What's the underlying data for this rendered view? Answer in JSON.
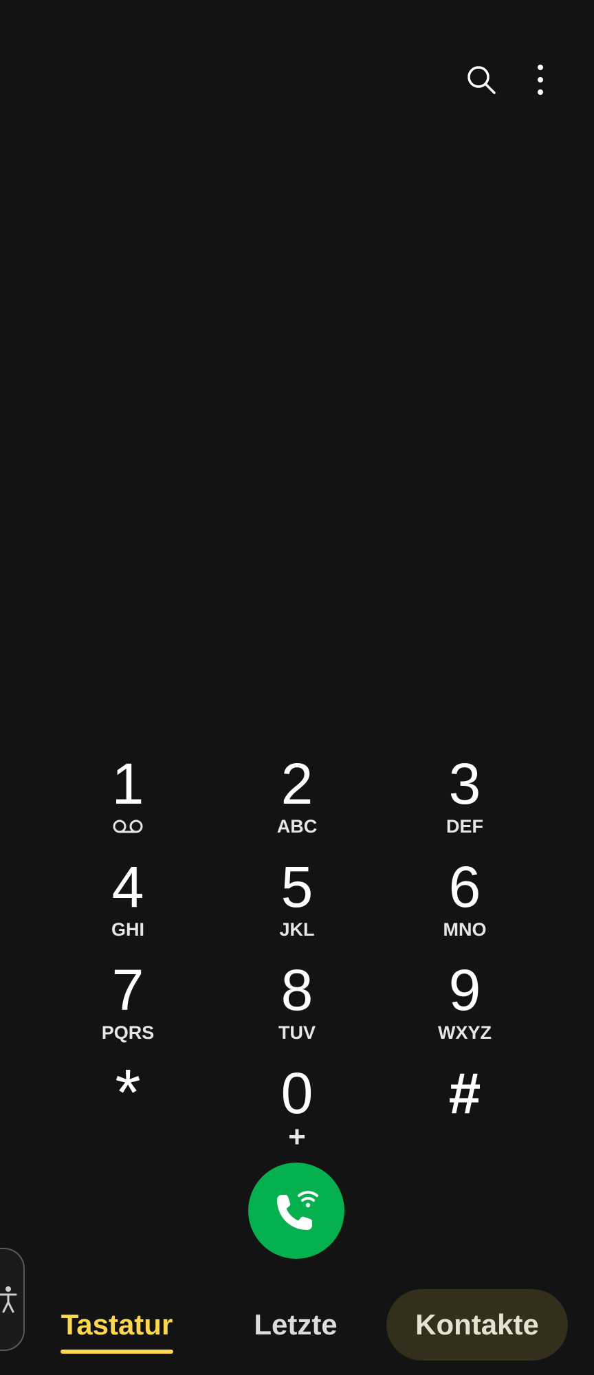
{
  "top_bar": {
    "search_icon": "search-icon",
    "more_icon": "more-vertical-icon"
  },
  "keypad": {
    "rows": [
      [
        {
          "digit": "1",
          "letters": "",
          "icon": "voicemail-icon"
        },
        {
          "digit": "2",
          "letters": "ABC"
        },
        {
          "digit": "3",
          "letters": "DEF"
        }
      ],
      [
        {
          "digit": "4",
          "letters": "GHI"
        },
        {
          "digit": "5",
          "letters": "JKL"
        },
        {
          "digit": "6",
          "letters": "MNO"
        }
      ],
      [
        {
          "digit": "7",
          "letters": "PQRS"
        },
        {
          "digit": "8",
          "letters": "TUV"
        },
        {
          "digit": "9",
          "letters": "WXYZ"
        }
      ],
      [
        {
          "digit": "*",
          "letters": ""
        },
        {
          "digit": "0",
          "letters": "+"
        },
        {
          "digit": "#",
          "letters": ""
        }
      ]
    ]
  },
  "call_button": {
    "icon": "wifi-call-icon",
    "color": "#05b04f"
  },
  "accessibility": {
    "icon": "accessibility-icon"
  },
  "bottom_nav": {
    "tabs": [
      {
        "label": "Tastatur",
        "active": true
      },
      {
        "label": "Letzte",
        "active": false
      },
      {
        "label": "Kontakte",
        "active": false
      }
    ],
    "active_color": "#fdd74f",
    "pill_color": "#342f1d"
  },
  "colors": {
    "background": "#131313",
    "text": "#ffffff"
  }
}
